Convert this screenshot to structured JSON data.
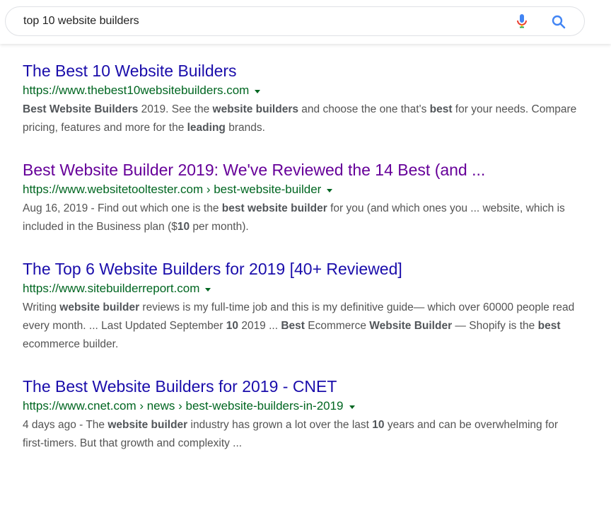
{
  "search": {
    "query": "top 10 website builders",
    "mic_icon": "microphone-icon",
    "search_icon": "magnifier-icon"
  },
  "colors": {
    "link": "#1a0dab",
    "visited_link": "#660099",
    "url": "#006621",
    "snippet": "#545454"
  },
  "results": [
    {
      "title": "The Best 10 Website Builders",
      "visited": false,
      "url": "https://www.thebest10websitebuilders.com",
      "snippet": [
        {
          "t": "Best Website Builders",
          "b": true
        },
        {
          "t": " 2019. See the ",
          "b": false
        },
        {
          "t": "website builders",
          "b": true
        },
        {
          "t": " and choose the one that's ",
          "b": false
        },
        {
          "t": "best",
          "b": true
        },
        {
          "t": " for your needs. Compare pricing, features and more for the ",
          "b": false
        },
        {
          "t": "leading",
          "b": true
        },
        {
          "t": " brands.",
          "b": false
        }
      ]
    },
    {
      "title": "Best Website Builder 2019: We've Reviewed the 14 Best (and ...",
      "visited": true,
      "url": "https://www.websitetooltester.com › best-website-builder",
      "snippet": [
        {
          "t": "Aug 16, 2019 - Find out which one is the ",
          "b": false
        },
        {
          "t": "best website builder",
          "b": true
        },
        {
          "t": " for you (and which ones you ... website, which is included in the Business plan ($",
          "b": false
        },
        {
          "t": "10",
          "b": true
        },
        {
          "t": " per month).",
          "b": false
        }
      ]
    },
    {
      "title": "The Top 6 Website Builders for 2019 [40+ Reviewed]",
      "visited": false,
      "url": "https://www.sitebuilderreport.com",
      "snippet": [
        {
          "t": "Writing ",
          "b": false
        },
        {
          "t": "website builder",
          "b": true
        },
        {
          "t": " reviews is my full-time job and this is my definitive guide— which over 60000 people read every month. ... Last Updated September ",
          "b": false
        },
        {
          "t": "10",
          "b": true
        },
        {
          "t": " 2019 ... ",
          "b": false
        },
        {
          "t": "Best",
          "b": true
        },
        {
          "t": " Ecommerce ",
          "b": false
        },
        {
          "t": "Website Builder",
          "b": true
        },
        {
          "t": " — Shopify is the ",
          "b": false
        },
        {
          "t": "best",
          "b": true
        },
        {
          "t": " ecommerce builder.",
          "b": false
        }
      ]
    },
    {
      "title": "The Best Website Builders for 2019 - CNET",
      "visited": false,
      "url": "https://www.cnet.com › news › best-website-builders-in-2019",
      "snippet": [
        {
          "t": "4 days ago - The ",
          "b": false
        },
        {
          "t": "website builder",
          "b": true
        },
        {
          "t": " industry has grown a lot over the last ",
          "b": false
        },
        {
          "t": "10",
          "b": true
        },
        {
          "t": " years and can be overwhelming for first-timers. But that growth and complexity ...",
          "b": false
        }
      ]
    }
  ]
}
